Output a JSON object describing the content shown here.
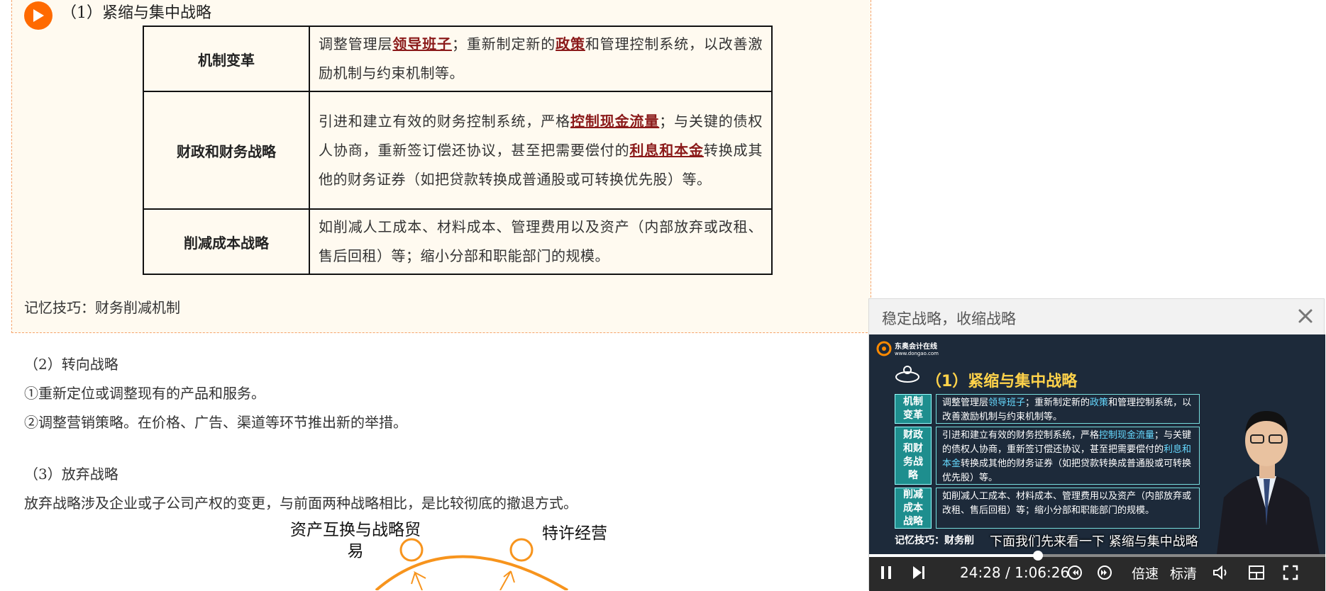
{
  "section1": {
    "title": "（1）紧缩与集中战略",
    "rows": [
      {
        "header": "机制变革",
        "content": [
          {
            "t": "调整管理层"
          },
          {
            "t": "领导班子",
            "kw": true
          },
          {
            "t": "；重新制定新的"
          },
          {
            "t": "政策",
            "kw": true
          },
          {
            "t": "和管理控制系统，以改善激励机制与约束机制等。"
          }
        ]
      },
      {
        "header": "财政和财务战略",
        "content": [
          {
            "t": "引进和建立有效的财务控制系统，严格"
          },
          {
            "t": "控制现金流量",
            "kw": true
          },
          {
            "t": "；与关键的债权人协商，重新签订偿还协议，甚至把需要偿付的"
          },
          {
            "t": "利息和本金",
            "kw": true
          },
          {
            "t": "转换成其他的财务证券（如把贷款转换成普通股或可转换优先股）等。"
          }
        ]
      },
      {
        "header": "削减成本战略",
        "content": [
          {
            "t": "如削减人工成本、材料成本、管理费用以及资产（内部放弃或改租、售后回租）等；缩小分部和职能部门的规模。"
          }
        ]
      }
    ],
    "memo": "记忆技巧：财务削减机制"
  },
  "section2": {
    "title": "（2）转向战略",
    "items": [
      "①重新定位或调整现有的产品和服务。",
      "②调整营销策略。在价格、广告、渠道等环节推出新的举措。"
    ]
  },
  "section3": {
    "title": "（3）放弃战略",
    "desc": "放弃战略涉及企业或子公司产权的变更，与前面两种战略相比，是比较彻底的撤退方式。",
    "diagram": {
      "label_left_1": "资产互换与战略贸",
      "label_left_2": "易",
      "label_right": "特许经营"
    }
  },
  "popup": {
    "title": "稳定战略，收缩战略",
    "slide": {
      "logo": "东奥会计在线",
      "logo_url": "www.dongao.com",
      "title": "（1）紧缩与集中战略",
      "rows": [
        {
          "head": "机制\n变革",
          "body": [
            {
              "t": "调整管理层"
            },
            {
              "t": "领导班子",
              "hl": true
            },
            {
              "t": "；重新制定新的"
            },
            {
              "t": "政策",
              "hl": true
            },
            {
              "t": "和管理控制系统，以改善激励机制与约束机制等。"
            }
          ]
        },
        {
          "head": "财政\n和财\n务战\n略",
          "body": [
            {
              "t": "引进和建立有效的财务控制系统，严格"
            },
            {
              "t": "控制现金流量",
              "hl": true
            },
            {
              "t": "；与关键的债权人协商，重新签订偿还协议，甚至把需要偿付的"
            },
            {
              "t": "利息和本金",
              "hl": true
            },
            {
              "t": "转换成其他的财务证券（如把贷款转换成普通股或可转换优先股）等。"
            }
          ]
        },
        {
          "head": "削减\n成本\n战略",
          "body": [
            {
              "t": "如削减人工成本、材料成本、管理费用以及资产（内部放弃或改租、售后回租）等；缩小分部和职能部门的规模。"
            }
          ]
        }
      ],
      "memo": "记忆技巧：财务削"
    },
    "subtitle": "下面我们先来看一下 紧缩与集中战略",
    "player": {
      "current_time": "24:28",
      "separator": "/",
      "total_time": "1:06:26",
      "progress": 0.37,
      "speed_label": "倍速",
      "quality_label": "标清"
    }
  },
  "colors": {
    "accent": "#ff6a00",
    "keyword": "#8b1a1a",
    "slide_highlight": "#66d9ff",
    "slide_title": "#ffd24a"
  }
}
